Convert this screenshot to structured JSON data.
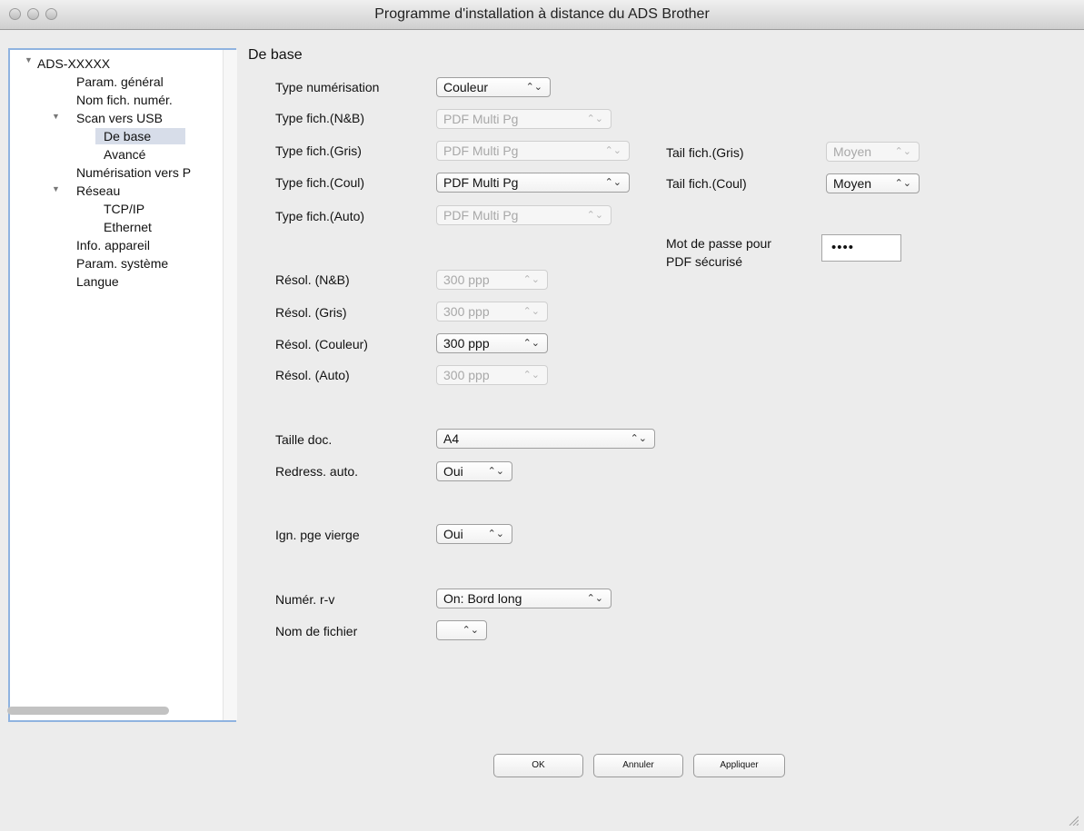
{
  "window": {
    "title": "Programme d'installation à distance du ADS Brother"
  },
  "tree": {
    "items": [
      {
        "label": "ADS-XXXXX",
        "expanded": true
      },
      {
        "label": "Param. général"
      },
      {
        "label": "Nom fich. numér."
      },
      {
        "label": "Scan vers USB",
        "expanded": true
      },
      {
        "label": "De base",
        "selected": true
      },
      {
        "label": "Avancé"
      },
      {
        "label": "Numérisation vers P"
      },
      {
        "label": "Réseau",
        "expanded": true
      },
      {
        "label": "TCP/IP"
      },
      {
        "label": "Ethernet"
      },
      {
        "label": "Info. appareil"
      },
      {
        "label": "Param. système"
      },
      {
        "label": "Langue"
      }
    ]
  },
  "section": {
    "title": "De base"
  },
  "form": {
    "scan_type": {
      "label": "Type numérisation",
      "value": "Couleur",
      "enabled": true
    },
    "file_type_bw": {
      "label": "Type fich.(N&B)",
      "value": "PDF Multi Pg",
      "enabled": false
    },
    "file_type_gray": {
      "label": "Type fich.(Gris)",
      "value": "PDF Multi Pg",
      "enabled": false
    },
    "file_type_color": {
      "label": "Type fich.(Coul)",
      "value": "PDF Multi Pg",
      "enabled": true
    },
    "file_type_auto": {
      "label": "Type fich.(Auto)",
      "value": "PDF Multi Pg",
      "enabled": false
    },
    "file_size_gray": {
      "label": "Tail fich.(Gris)",
      "value": "Moyen",
      "enabled": false
    },
    "file_size_color": {
      "label": "Tail fich.(Coul)",
      "value": "Moyen",
      "enabled": true
    },
    "pdf_password": {
      "label_line1": "Mot de passe pour",
      "label_line2": "PDF sécurisé",
      "value": "••••"
    },
    "res_bw": {
      "label": "Résol. (N&B)",
      "value": "300 ppp",
      "enabled": false
    },
    "res_gray": {
      "label": "Résol. (Gris)",
      "value": "300 ppp",
      "enabled": false
    },
    "res_color": {
      "label": "Résol. (Couleur)",
      "value": "300 ppp",
      "enabled": true
    },
    "res_auto": {
      "label": "Résol. (Auto)",
      "value": "300 ppp",
      "enabled": false
    },
    "doc_size": {
      "label": "Taille doc.",
      "value": "A4",
      "enabled": true
    },
    "auto_deskew": {
      "label": "Redress. auto.",
      "value": "Oui",
      "enabled": true
    },
    "skip_blank": {
      "label": "Ign. pge vierge",
      "value": "Oui",
      "enabled": true
    },
    "duplex": {
      "label": "Numér. r-v",
      "value": "On: Bord long",
      "enabled": true
    },
    "file_name": {
      "label": "Nom de fichier",
      "value": "",
      "enabled": true
    }
  },
  "buttons": {
    "ok": "OK",
    "cancel": "Annuler",
    "apply": "Appliquer"
  },
  "icons": {
    "expanded": "triangle-down-icon",
    "popup": "updown-chevron-icon",
    "resize": "resize-grip-icon"
  }
}
